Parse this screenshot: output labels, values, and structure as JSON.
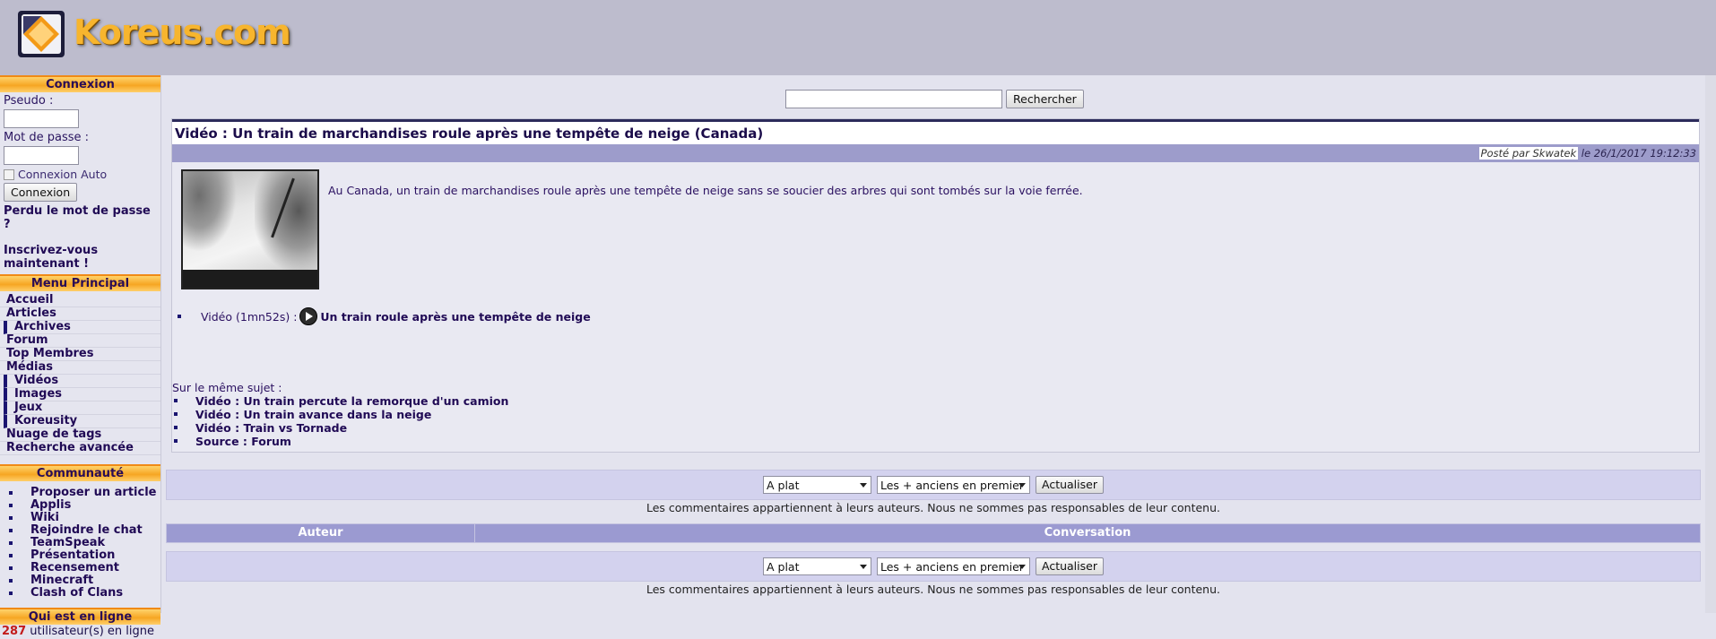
{
  "header": {
    "logo_text": "Koreus.com"
  },
  "login": {
    "title": "Connexion",
    "pseudo_label": "Pseudo :",
    "password_label": "Mot de passe :",
    "auto_label": "Connexion Auto",
    "button": "Connexion",
    "forgot": "Perdu le mot de passe ?",
    "register": "Inscrivez-vous maintenant !"
  },
  "menu": {
    "title": "Menu Principal",
    "items": [
      "Accueil",
      "Articles",
      "Archives",
      "Forum",
      "Top Membres",
      "Médias",
      "Vidéos",
      "Images",
      "Jeux",
      "Koreusity",
      "Nuage de tags",
      "Recherche avancée"
    ]
  },
  "community": {
    "title": "Communauté",
    "items": [
      "Proposer un article",
      "Applis",
      "Wiki",
      "Rejoindre le chat",
      "TeamSpeak",
      "Présentation",
      "Recensement",
      "Minecraft",
      "Clash of Clans"
    ]
  },
  "online": {
    "title": "Qui est en ligne",
    "count": "287",
    "suffix": "utilisateur(s) en ligne"
  },
  "search": {
    "button": "Rechercher",
    "value": ""
  },
  "article": {
    "title": "Vidéo : Un train de marchandises roule après une tempête de neige (Canada)",
    "posted_by": "Posté par Skwatek",
    "posted_date": "le 26/1/2017 19:12:33",
    "description": "Au Canada, un train de marchandises roule après une tempête de neige sans se soucier des arbres qui sont tombés sur la voie ferrée.",
    "video_prefix": "Vidéo (1mn52s) :",
    "video_link": "Un train roule après une tempête de neige",
    "related_label": "Sur le même sujet :",
    "related": [
      "Vidéo : Un train percute la remorque d'un camion",
      "Vidéo : Un train avance dans la neige",
      "Vidéo : Train vs Tornade",
      "Source : Forum"
    ]
  },
  "comments": {
    "mode": "A plat",
    "order": "Les + anciens en premier",
    "refresh": "Actualiser",
    "disclaimer": "Les commentaires appartiennent à leurs auteurs. Nous ne sommes pas responsables de leur contenu.",
    "col_author": "Auteur",
    "col_conversation": "Conversation"
  }
}
